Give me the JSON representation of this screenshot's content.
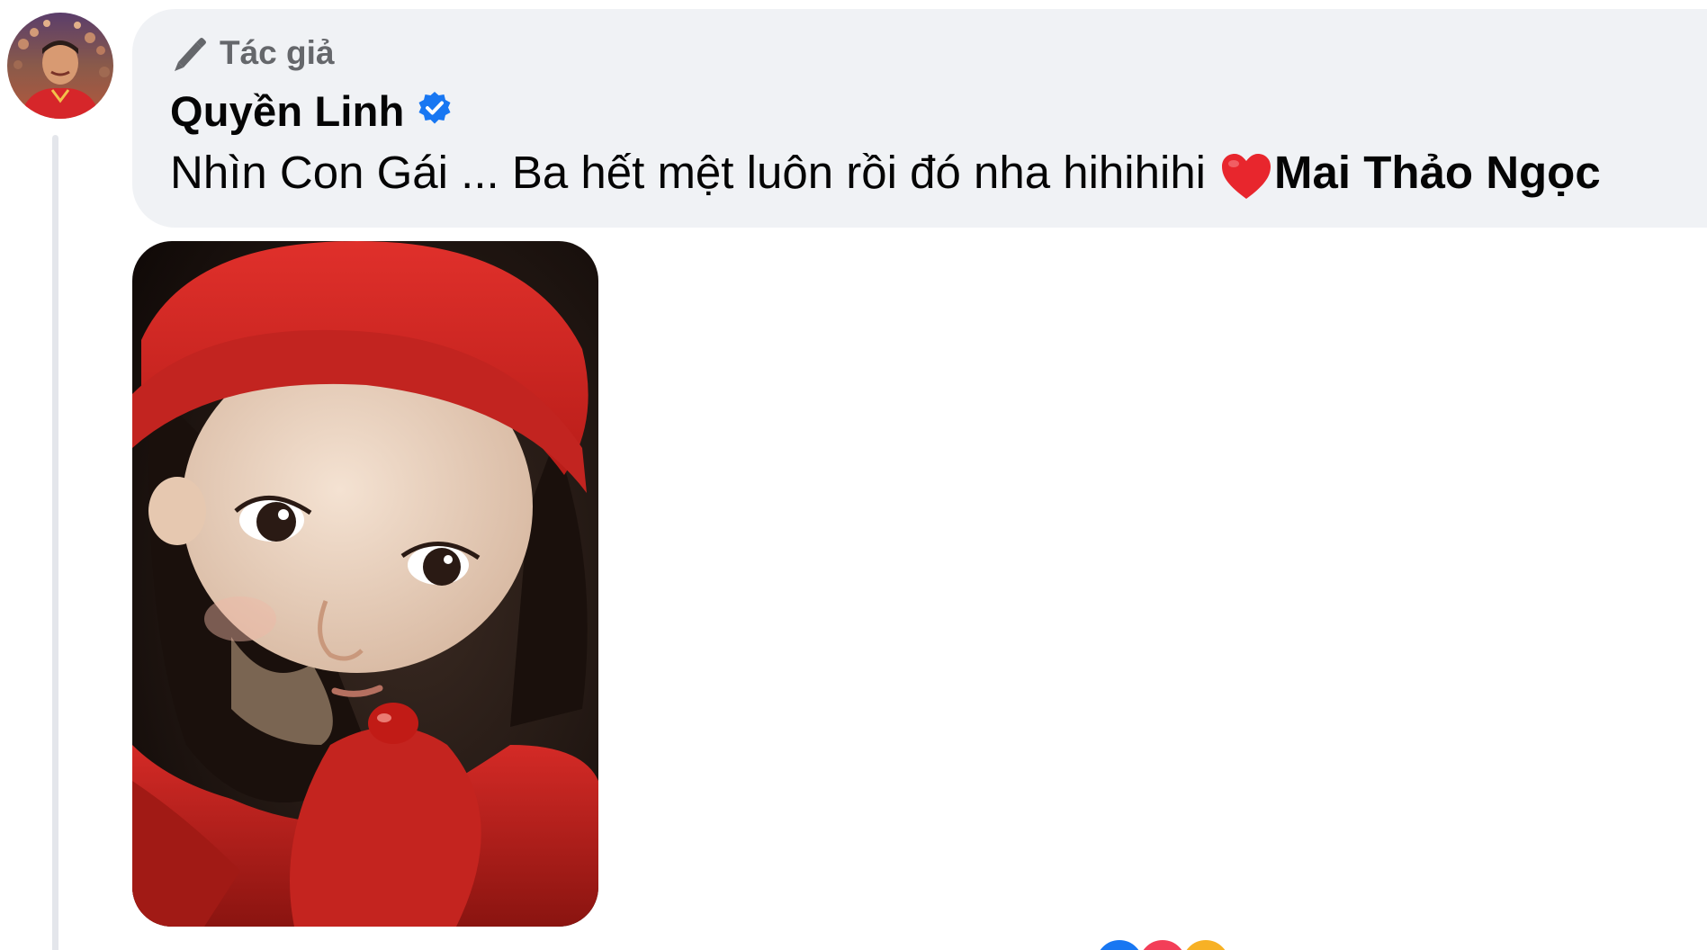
{
  "comment": {
    "author_badge_label": "Tác giả",
    "commenter_name": "Quyền Linh",
    "text": "Nhìn Con Gái ... Ba hết mệt luôn rồi đó nha hihihihi",
    "mention": "Mai Thảo Ngọc",
    "emoji": "heart-emoji"
  },
  "icons": {
    "author": "pen-icon",
    "verified": "verified-badge-icon"
  },
  "reactions": [
    "like",
    "love",
    "haha"
  ],
  "colors": {
    "bubble": "#f0f2f5",
    "secondary_text": "#65676b",
    "primary_text": "#050505",
    "verified": "#1877f2",
    "thread_line": "#e4e6eb",
    "heart": "#e8262d"
  }
}
